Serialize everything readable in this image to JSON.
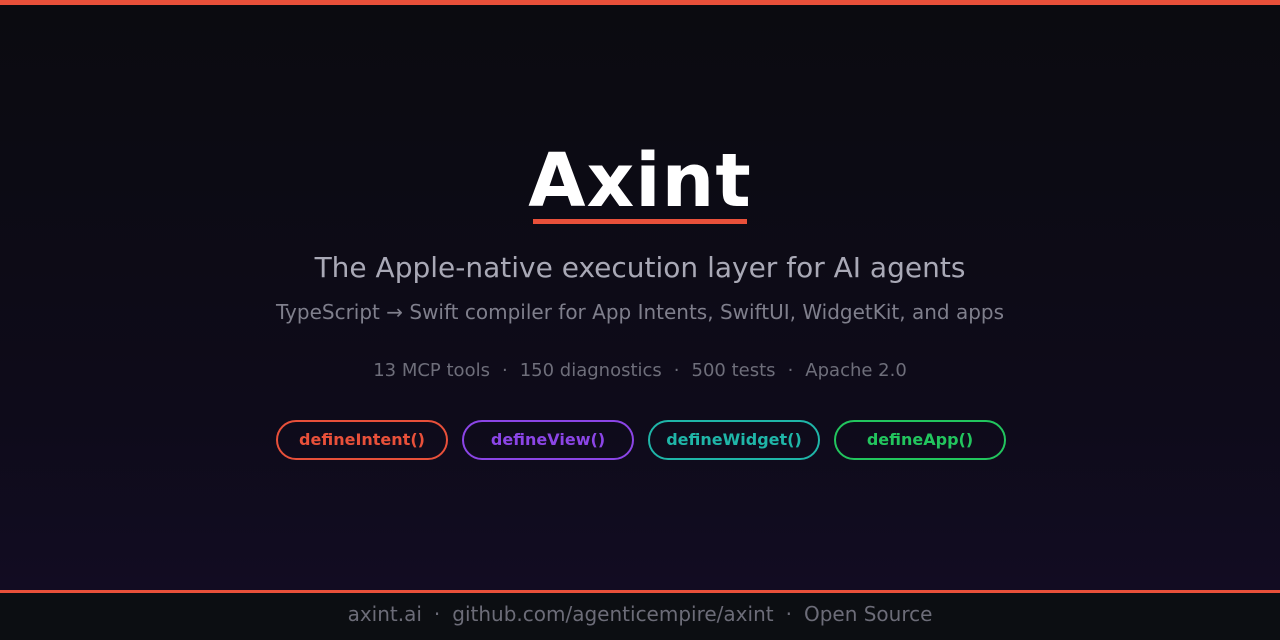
{
  "hero": {
    "title": "Axint",
    "subtitle": "The Apple-native execution layer for AI agents",
    "tagline": "TypeScript → Swift compiler for App Intents, SwiftUI, WidgetKit, and apps"
  },
  "stats": {
    "items": [
      "13 MCP tools",
      "150 diagnostics",
      "500 tests",
      "Apache 2.0"
    ],
    "separator": "·"
  },
  "pills": [
    {
      "label": "defineIntent()",
      "color": "#e8503a"
    },
    {
      "label": "defineView()",
      "color": "#8b45e6"
    },
    {
      "label": "defineWidget()",
      "color": "#1fb5a8"
    },
    {
      "label": "defineApp()",
      "color": "#22c55e"
    }
  ],
  "footer": {
    "items": [
      "axint.ai",
      "github.com/agenticempire/axint",
      "Open Source"
    ],
    "separator": "·"
  },
  "colors": {
    "accent": "#e8503a",
    "background": "#0b0b10"
  }
}
